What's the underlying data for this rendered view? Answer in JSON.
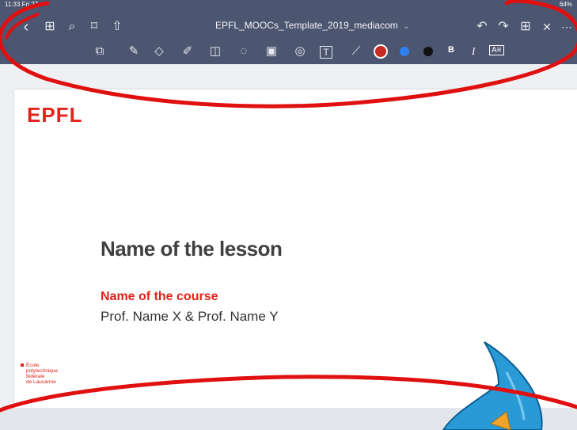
{
  "status_bar": {
    "time": "11:33  Fri 27 ",
    "battery": "64%"
  },
  "nav": {
    "back_icon": "‹",
    "grid_icon": "⊞",
    "search_icon": "⌕",
    "bookmark_icon": "⌑",
    "share_icon": "⇧",
    "title": "EPFL_MOOCs_Template_2019_mediacom",
    "title_chevron": "⌄",
    "undo_icon": "↶",
    "redo_icon": "↷",
    "add_page_icon": "⊞",
    "close_icon": "✕",
    "more_icon": "⋯"
  },
  "toolbar": {
    "read_mode_icon": "⧉",
    "pen_icon": "✎",
    "eraser_icon": "◇",
    "highlighter_icon": "✐",
    "shapes_icon": "◫",
    "lasso_icon": "◌",
    "image_icon": "▣",
    "camera_icon": "◎",
    "textbox_icon": "T",
    "laser_icon": "⟋",
    "colors": [
      "#c62b22",
      "#2f7ff0",
      "#111111"
    ],
    "bold_label": "B",
    "italic_label": "I",
    "textstyle_label": "A≡"
  },
  "slide": {
    "logo_text": "EPFL",
    "lesson_title": "Name of the lesson",
    "course_name": "Name of the course",
    "professors": "Prof. Name X & Prof. Name Y",
    "footer_lines": [
      "École",
      "polytechnique",
      "fédérale",
      "de Lausanne"
    ]
  },
  "colors": {
    "accent": "#e2231a",
    "toolbar_bg": "#4d5670",
    "annotation": "#e01010",
    "character": "#2a9ad6"
  }
}
